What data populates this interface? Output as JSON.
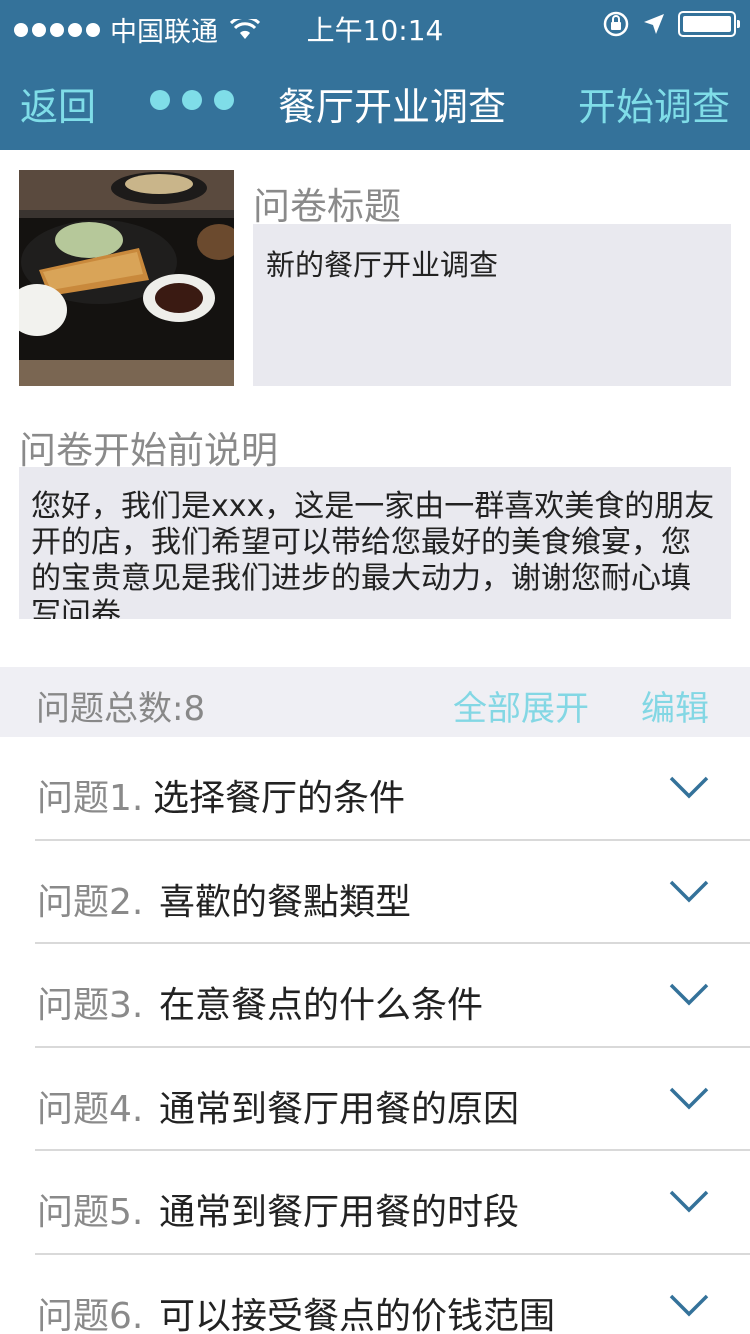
{
  "status_bar": {
    "carrier": "中国联通",
    "time": "上午10:14"
  },
  "nav": {
    "back_label": "返回",
    "title": "餐厅开业调查",
    "start_label": "开始调查"
  },
  "form": {
    "title_label": "问卷标题",
    "title_value": "新的餐厅开业调查",
    "desc_label": "问卷开始前说明",
    "desc_value": "您好，我们是xxx，这是一家由一群喜欢美食的朋友开的店，我们希望可以带给您最好的美食飨宴，您的宝贵意见是我们进步的最大动力，谢谢您耐心填写问卷"
  },
  "summary": {
    "count_label": "问题总数:8",
    "expand_label": "全部展开",
    "edit_label": "编辑"
  },
  "questions": [
    {
      "num": "问题1.",
      "text": "选择餐厅的条件"
    },
    {
      "num": "问题2.",
      "text": "喜歡的餐點類型"
    },
    {
      "num": "问题3.",
      "text": "在意餐点的什么条件"
    },
    {
      "num": "问题4.",
      "text": "通常到餐厅用餐的原因"
    },
    {
      "num": "问题5.",
      "text": "通常到餐厅用餐的时段"
    },
    {
      "num": "问题6.",
      "text": "可以接受餐点的价钱范围"
    }
  ],
  "colors": {
    "bar": "#34729a",
    "accent": "#7fdde8",
    "chevron": "#34729a"
  }
}
